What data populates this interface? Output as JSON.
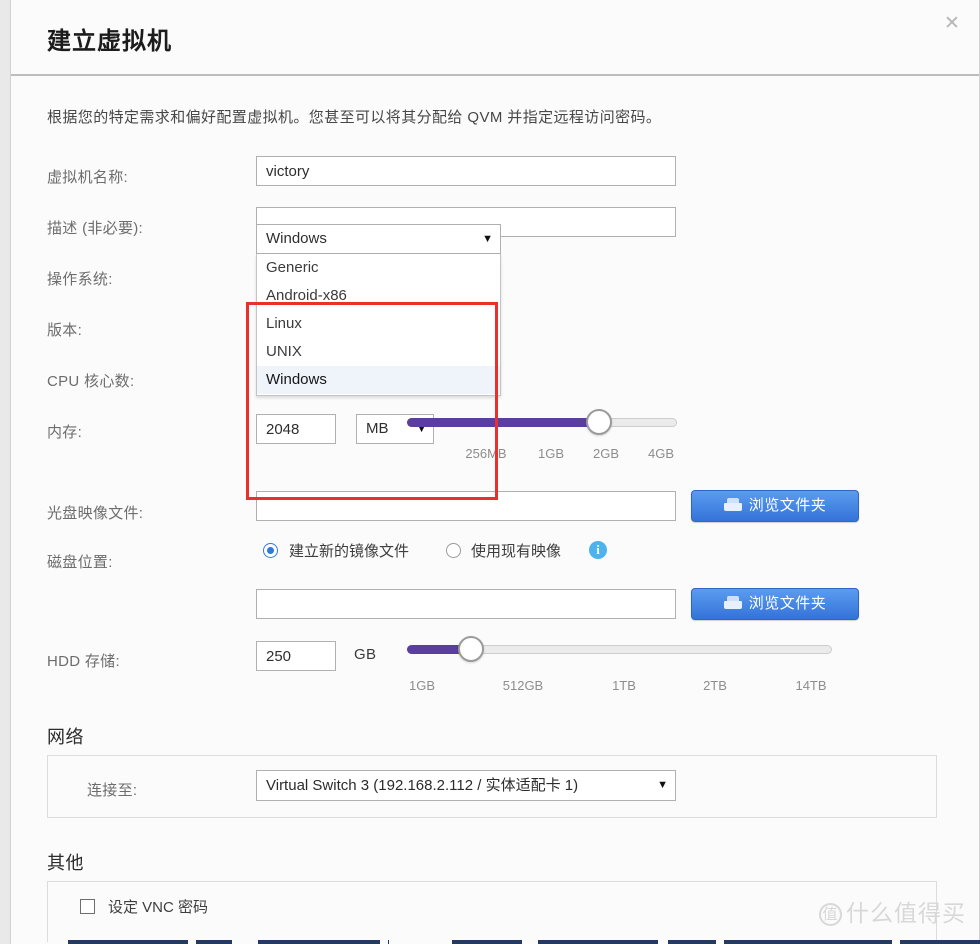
{
  "dialog": {
    "title": "建立虚拟机",
    "close_label": "✕",
    "intro": "根据您的特定需求和偏好配置虚拟机。您甚至可以将其分配给 QVM 并指定远程访问密码。"
  },
  "fields": {
    "vm_name": {
      "label": "虚拟机名称:",
      "value": "victory",
      "placeholder": ""
    },
    "description": {
      "label": "描述 (非必要):",
      "value": "",
      "placeholder": ""
    },
    "os": {
      "label": "操作系统:",
      "selected": "Windows"
    },
    "version": {
      "label": "版本:"
    },
    "cpu_cores": {
      "label": "CPU 核心数:"
    },
    "memory": {
      "label": "内存:",
      "value": "2048",
      "unit": "MB"
    },
    "iso_image": {
      "label": "光盘映像文件:",
      "value": "",
      "placeholder": ""
    },
    "disk_location": {
      "label": "磁盘位置:",
      "value": "",
      "placeholder": ""
    },
    "hdd_storage": {
      "label": "HDD 存储:",
      "value": "250",
      "unit": "GB"
    }
  },
  "os_dropdown": {
    "options": [
      "Generic",
      "Android-x86",
      "Linux",
      "UNIX",
      "Windows"
    ],
    "highlighted": "Windows"
  },
  "memory_slider": {
    "ticks": [
      "256MB",
      "1GB",
      "2GB",
      "4GB"
    ],
    "value_label": "2GB",
    "fill_percent": 71
  },
  "hdd_slider": {
    "ticks": [
      "1GB",
      "512GB",
      "1TB",
      "2TB",
      "14TB"
    ],
    "value_label": "250GB",
    "fill_percent": 15
  },
  "disk_mode": {
    "create_new_label": "建立新的镜像文件",
    "use_existing_label": "使用现有映像",
    "selected": "create_new",
    "info_icon": "i"
  },
  "browse_buttons": {
    "iso_label": "浏览文件夹",
    "disk_label": "浏览文件夹",
    "icon": "folder-icon"
  },
  "network": {
    "section_title": "网络",
    "connect_label": "连接至:",
    "selected": "Virtual Switch 3 (192.168.2.112 / 实体适配卡 1)"
  },
  "other": {
    "section_title": "其他",
    "vnc_password_label": "设定 VNC 密码",
    "vnc_checked": false
  },
  "watermark": {
    "mark": "值",
    "text": "什么值得买"
  },
  "colors": {
    "accent_purple": "#5b3fa0",
    "button_blue": "#3473d8",
    "annotation_red": "#e8312a",
    "info_blue": "#4cb3ee"
  }
}
